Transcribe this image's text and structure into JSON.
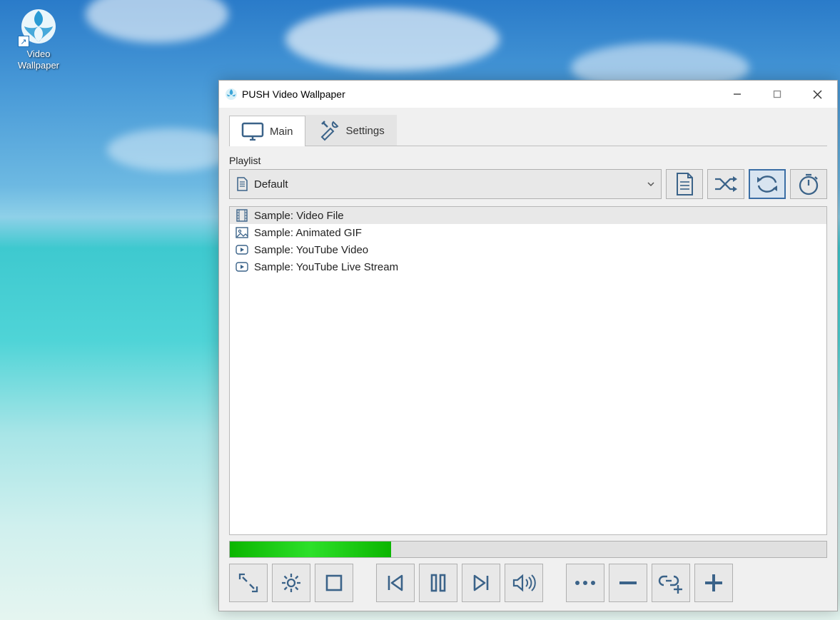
{
  "desktop": {
    "icon_label": "Video Wallpaper"
  },
  "window": {
    "title": "PUSH Video Wallpaper"
  },
  "tabs": {
    "main": "Main",
    "settings": "Settings"
  },
  "playlist": {
    "label": "Playlist",
    "selected": "Default"
  },
  "items": [
    {
      "label": "Sample: Video File",
      "type": "video"
    },
    {
      "label": "Sample: Animated GIF",
      "type": "image"
    },
    {
      "label": "Sample: YouTube Video",
      "type": "youtube"
    },
    {
      "label": "Sample: YouTube Live Stream",
      "type": "youtube"
    }
  ],
  "progress_percent": 27,
  "colors": {
    "icon": "#3b6389",
    "accent": "#3b6ea5",
    "progress": "#15c415"
  }
}
